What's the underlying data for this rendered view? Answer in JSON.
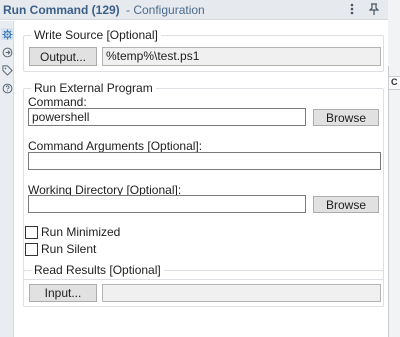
{
  "window": {
    "title": "Run Command (129)",
    "subtitle": "- Configuration"
  },
  "title_buttons": {
    "menu_icon": "⋮",
    "pin_icon": "📌"
  },
  "sidebar": {
    "icons": [
      "gear-icon",
      "arrow-circle-icon",
      "tag-icon",
      "help-icon"
    ]
  },
  "right_panel": {
    "tab_label": "C"
  },
  "write_source": {
    "title": "Write Source [Optional]",
    "output_button": "Output...",
    "output_path": "%temp%\\test.ps1"
  },
  "run_external": {
    "title": "Run External Program",
    "command_label": "Command:",
    "command_value": "powershell",
    "browse_label": "Browse",
    "arguments_label": "Command Arguments [Optional]:",
    "arguments_value": "",
    "working_dir_label": "Working Directory [Optional]:",
    "working_dir_value": "",
    "browse_label_2": "Browse",
    "run_minimized_label": "Run Minimized",
    "run_minimized_checked": false,
    "run_silent_label": "Run Silent",
    "run_silent_checked": false
  },
  "read_results": {
    "title": "Read Results [Optional]",
    "input_button": "Input...",
    "input_path": ""
  },
  "colors": {
    "title_text": "#3b5f86",
    "titlebar_bg": "#e6eaef",
    "button_bg": "#e1e1e1"
  }
}
